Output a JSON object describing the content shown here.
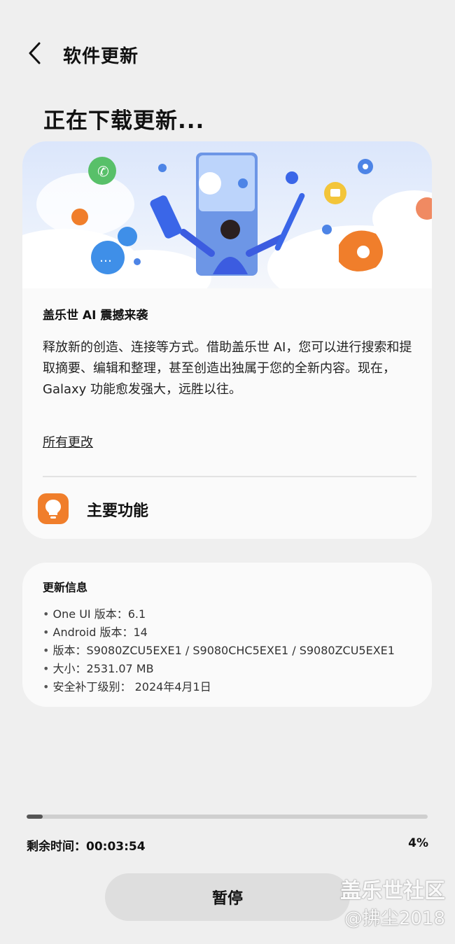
{
  "header": {
    "title": "软件更新"
  },
  "status": {
    "title": "正在下载更新..."
  },
  "feature_card": {
    "title": "盖乐世 AI 震撼来袭",
    "description": "释放新的创造、连接等方式。借助盖乐世 AI，您可以进行搜索和提取摘要、编辑和整理，甚至创造出独属于您的全新内容。现在，Galaxy 功能愈发强大，远胜以往。",
    "all_changes": "所有更改",
    "main_features": "主要功能"
  },
  "update_info": {
    "title": "更新信息",
    "items": [
      "One UI 版本：6.1",
      "Android 版本：14",
      "版本：S9080ZCU5EXE1 / S9080CHC5EXE1 / S9080ZCU5EXE1",
      "大小：2531.07 MB",
      "安全补丁级别： 2024年4月1日"
    ]
  },
  "progress": {
    "remaining_label": "剩余时间：00:03:54",
    "percent_label": "4%",
    "value": 0.04
  },
  "actions": {
    "pause": "暂停"
  },
  "watermark": {
    "line1": "盖乐世社区",
    "line2": "@拂尘2018"
  },
  "colors": {
    "background": "#efefef",
    "card": "#fafafa",
    "accent_orange": "#f07e2b",
    "progress_fill": "#555555",
    "progress_track": "#cfcfcf"
  },
  "icons": {
    "back": "chevron-left-icon",
    "main_features": "lightbulb-icon"
  }
}
